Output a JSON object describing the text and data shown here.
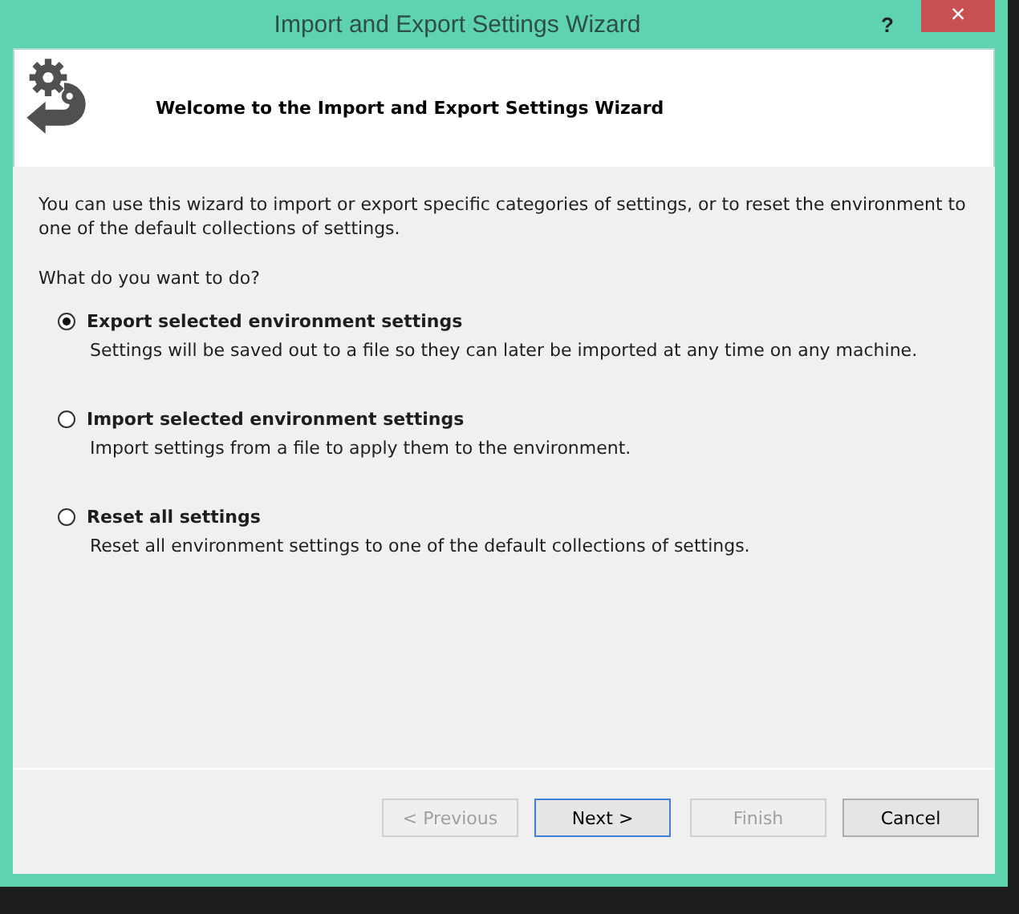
{
  "window": {
    "title": "Import and Export Settings Wizard",
    "help": "?",
    "close": "×"
  },
  "header": {
    "title": "Welcome to the Import and Export Settings Wizard"
  },
  "intro": "You can use this wizard to import or export specific categories of settings, or to reset the environment to one of the default collections of settings.",
  "question": "What do you want to do?",
  "options": [
    {
      "label": "Export selected environment settings",
      "description": "Settings will be saved out to a file so they can later be imported at any time on any machine.",
      "selected": true
    },
    {
      "label": "Import selected environment settings",
      "description": "Import settings from a file to apply them to the environment.",
      "selected": false
    },
    {
      "label": "Reset all settings",
      "description": "Reset all environment settings to one of the default collections of settings.",
      "selected": false
    }
  ],
  "buttons": [
    {
      "label": "< Previous",
      "disabled": true,
      "default": false
    },
    {
      "label": "Next >",
      "disabled": false,
      "default": true
    },
    {
      "label": "Finish",
      "disabled": true,
      "default": false
    },
    {
      "label": "Cancel",
      "disabled": false,
      "default": false
    }
  ]
}
